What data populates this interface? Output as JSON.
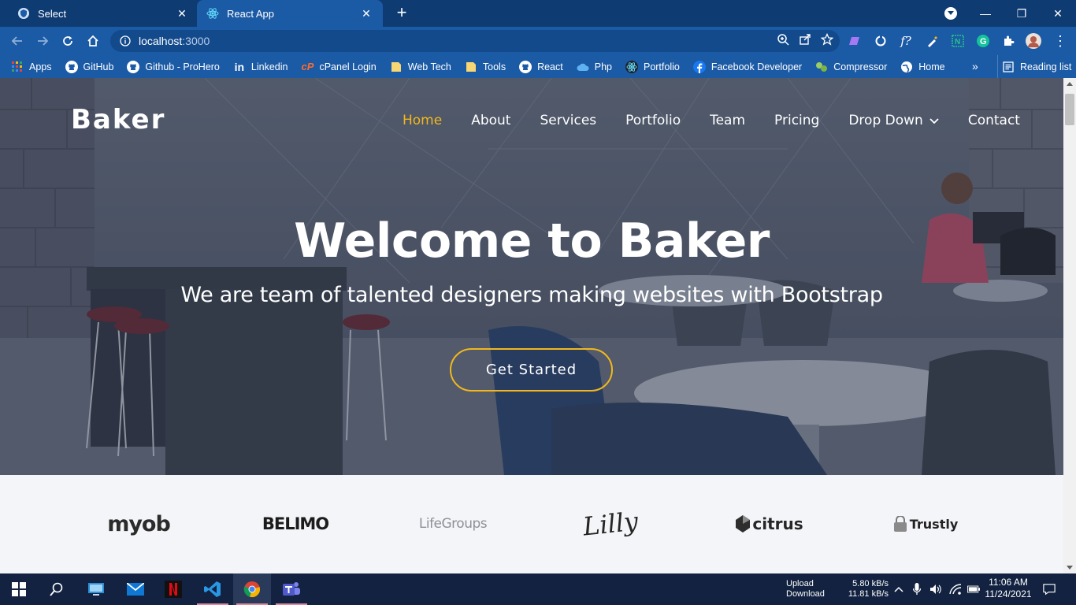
{
  "browser": {
    "tabs": [
      {
        "title": "Select",
        "active": false
      },
      {
        "title": "React App",
        "active": true
      }
    ],
    "address": {
      "host": "localhost",
      "port": ":3000"
    },
    "bookmarks": [
      {
        "label": "Apps",
        "icon": "apps-grid-icon"
      },
      {
        "label": "GitHub",
        "icon": "github-icon"
      },
      {
        "label": "Github - ProHero",
        "icon": "github-icon"
      },
      {
        "label": "Linkedin",
        "icon": "linkedin-icon"
      },
      {
        "label": "cPanel Login",
        "icon": "cpanel-icon"
      },
      {
        "label": "Web Tech",
        "icon": "folder-icon"
      },
      {
        "label": "Tools",
        "icon": "folder-icon"
      },
      {
        "label": "React",
        "icon": "github-icon"
      },
      {
        "label": "Php",
        "icon": "cloud-icon"
      },
      {
        "label": "Portfolio",
        "icon": "react-icon"
      },
      {
        "label": "Facebook Developer",
        "icon": "facebook-icon"
      },
      {
        "label": "Compressor",
        "icon": "compressor-icon"
      },
      {
        "label": "Home",
        "icon": "globe-icon"
      }
    ],
    "more_bookmarks": "»",
    "reading_list": "Reading list"
  },
  "site": {
    "logo": "Baker",
    "nav": [
      "Home",
      "About",
      "Services",
      "Portfolio",
      "Team",
      "Pricing",
      "Drop Down",
      "Contact"
    ],
    "active_nav": "Home",
    "hero": {
      "title": "Welcome to Baker",
      "subtitle": "We are team of talented designers making websites with Bootstrap",
      "cta": "Get Started"
    },
    "clients": [
      "myob",
      "BELIMO",
      "LifeGroups",
      "Lilly",
      "citrus",
      "Trustly"
    ],
    "accent_color": "#f2b71c"
  },
  "taskbar": {
    "net_labels": {
      "upload": "Upload",
      "download": "Download"
    },
    "net_speeds": {
      "upload": "5.80 kB/s",
      "download": "11.81 kB/s"
    },
    "time": "11:06 AM",
    "date": "11/24/2021"
  }
}
